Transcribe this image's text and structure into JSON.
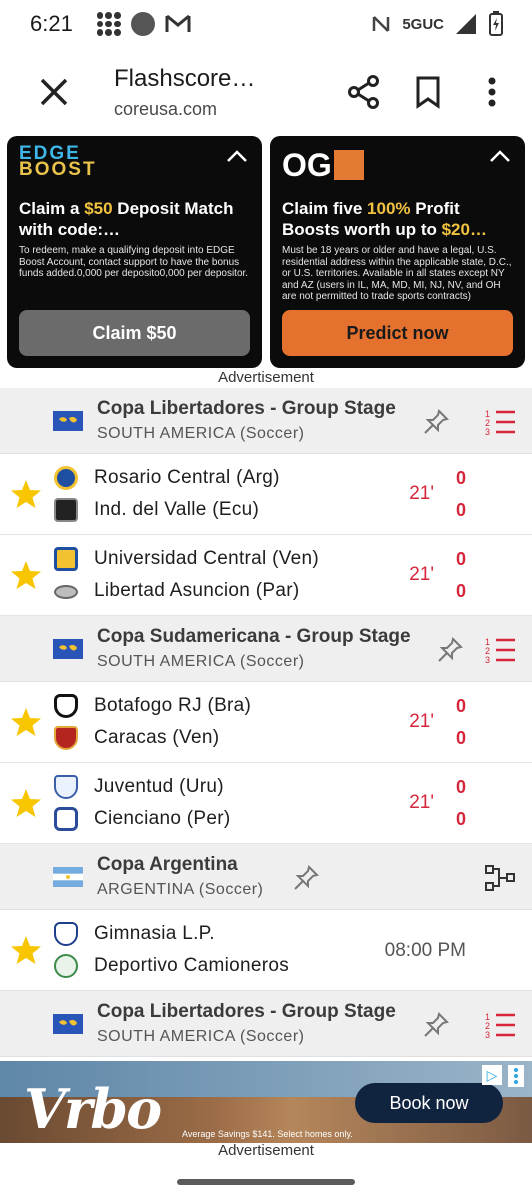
{
  "status": {
    "time": "6:21",
    "network": "5GUC"
  },
  "browser": {
    "title": "Flashscore…",
    "url": "coreusa.com"
  },
  "ads": [
    {
      "logo_line1": "EDGE",
      "logo_line2": "BOOST",
      "headline_pre": "Claim a ",
      "headline_hl": "$50",
      "headline_post": " Deposit Match with code:…",
      "fine": "To redeem, make a qualifying deposit into EDGE Boost Account, contact support to have the bonus funds added.0,000 per deposito0,000 per depositor.",
      "cta": "Claim $50"
    },
    {
      "logo": "OG",
      "headline_pre": "Claim five ",
      "headline_hl": "100%",
      "headline_mid": " Profit Boosts worth up to ",
      "headline_hl2": "$20…",
      "fine": "Must be 18 years or older and have a legal, U.S. residential address within the applicable state, D.C., or U.S. territories. Available in all states except NY and AZ (users in IL, MA, MD, MI, NJ, NV, and OH are not permitted to trade sports contracts)",
      "cta": "Predict now"
    }
  ],
  "ad_label": "Advertisement",
  "leagues": [
    {
      "name": "Copa Libertadores - Group Stage",
      "country": "SOUTH AMERICA",
      "sport": "(Soccer)",
      "icon": "standings-icon",
      "matches": [
        {
          "home": "Rosario Central (Arg)",
          "away": "Ind. del Valle (Ecu)",
          "status": "21'",
          "home_score": "0",
          "away_score": "0"
        },
        {
          "home": "Universidad Central (Ven)",
          "away": "Libertad Asuncion (Par)",
          "status": "21'",
          "home_score": "0",
          "away_score": "0"
        }
      ]
    },
    {
      "name": "Copa Sudamericana - Group Stage",
      "country": "SOUTH AMERICA",
      "sport": "(Soccer)",
      "icon": "standings-icon",
      "matches": [
        {
          "home": "Botafogo RJ (Bra)",
          "away": "Caracas (Ven)",
          "status": "21'",
          "home_score": "0",
          "away_score": "0"
        },
        {
          "home": "Juventud (Uru)",
          "away": "Cienciano (Per)",
          "status": "21'",
          "home_score": "0",
          "away_score": "0"
        }
      ]
    },
    {
      "name": "Copa Argentina",
      "country": "ARGENTINA",
      "sport": "(Soccer)",
      "icon": "bracket-icon",
      "matches": [
        {
          "home": "Gimnasia L.P.",
          "away": "Deportivo Camioneros",
          "time": "08:00 PM"
        }
      ]
    },
    {
      "name": "Copa Libertadores - Group Stage",
      "country": "SOUTH AMERICA",
      "sport": "(Soccer)",
      "icon": "standings-icon"
    }
  ],
  "bottom_ad": {
    "brand": "Vrbo",
    "cta": "Book now",
    "small": "Average Savings $141. Select homes only."
  },
  "colors": {
    "live_red": "#d5263b",
    "star": "#f7c600",
    "orange_cta": "#e5712f"
  }
}
